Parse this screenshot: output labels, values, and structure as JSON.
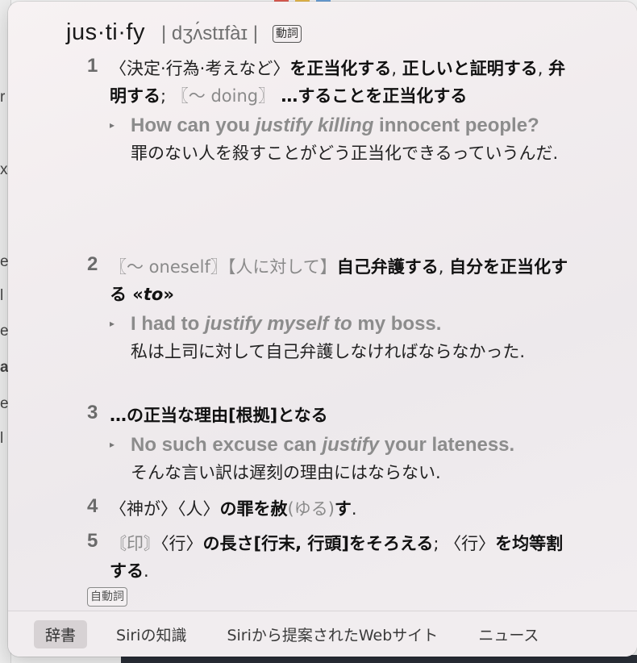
{
  "entry": {
    "headword": "jus·ti·fy",
    "pronunciation": "| dʒʌ́stɪfàɪ |",
    "pos_badge": "動詞",
    "intrans_badge": "自動詞"
  },
  "senses": [
    {
      "num": "1",
      "def_parts": [
        {
          "t": "〈決定·行為·考えなど〉",
          "s": "norm"
        },
        {
          "t": "を正当化する",
          "s": "bold"
        },
        {
          "t": ", ",
          "s": "norm"
        },
        {
          "t": "正しいと証明する",
          "s": "bold"
        },
        {
          "t": ", ",
          "s": "norm"
        },
        {
          "t": "弁明する",
          "s": "bold"
        },
        {
          "t": "; ",
          "s": "norm"
        },
        {
          "t": "〖～ doing〗",
          "s": "light"
        },
        {
          "t": " …することを正当化する",
          "s": "bold"
        }
      ],
      "example_en_parts": [
        {
          "t": "How can you ",
          "s": "norm"
        },
        {
          "t": "justify killing",
          "s": "it"
        },
        {
          "t": " innocent people?",
          "s": "norm"
        }
      ],
      "example_ja": "罪のない人を殺すことがどう正当化できるっていうんだ."
    },
    {
      "num": "2",
      "def_parts": [
        {
          "t": "〖～ oneself〗",
          "s": "light"
        },
        {
          "t": "【人に対して】",
          "s": "light"
        },
        {
          "t": "自己弁護する",
          "s": "bold"
        },
        {
          "t": ", ",
          "s": "norm"
        },
        {
          "t": "自分を正当化する",
          "s": "bold"
        },
        {
          "t": " «",
          "s": "bold"
        },
        {
          "t": "to",
          "s": "it"
        },
        {
          "t": "»",
          "s": "bold"
        }
      ],
      "example_en_parts": [
        {
          "t": "I had to ",
          "s": "norm"
        },
        {
          "t": "justify myself to",
          "s": "it"
        },
        {
          "t": " my boss.",
          "s": "norm"
        }
      ],
      "example_ja": "私は上司に対して自己弁護しなければならなかった."
    },
    {
      "num": "3",
      "def_parts": [
        {
          "t": "…の正当な理由[根拠]となる",
          "s": "bold"
        }
      ],
      "example_en_parts": [
        {
          "t": "No such excuse can ",
          "s": "norm"
        },
        {
          "t": "justify",
          "s": "it"
        },
        {
          "t": " your lateness.",
          "s": "norm"
        }
      ],
      "example_ja": "そんな言い訳は遅刻の理由にはならない."
    },
    {
      "num": "4",
      "def_parts": [
        {
          "t": "〈神が〉〈人〉",
          "s": "norm"
        },
        {
          "t": "の罪を赦",
          "s": "bold"
        },
        {
          "t": "(ゆる)",
          "s": "light"
        },
        {
          "t": "す",
          "s": "bold"
        },
        {
          "t": ".",
          "s": "norm"
        }
      ]
    },
    {
      "num": "5",
      "def_parts": [
        {
          "t": "〘印〙",
          "s": "light"
        },
        {
          "t": "〈行〉",
          "s": "norm"
        },
        {
          "t": "の長さ[行末, 行頭]をそろえる",
          "s": "bold"
        },
        {
          "t": "; ",
          "s": "norm"
        },
        {
          "t": "〈行〉",
          "s": "norm"
        },
        {
          "t": "を均等割する",
          "s": "bold"
        },
        {
          "t": ".",
          "s": "norm"
        }
      ]
    }
  ],
  "tabs": [
    {
      "label": "辞書",
      "active": true
    },
    {
      "label": "Siriの知識",
      "active": false
    },
    {
      "label": "Siriから提案されたWebサイト",
      "active": false
    },
    {
      "label": "ニュース",
      "active": false
    }
  ],
  "background": {
    "left_letters": [
      "r",
      "x",
      "e",
      "l",
      "e",
      "a",
      "e",
      "l"
    ]
  },
  "colors": {
    "popover_bg": "#f1ecee",
    "active_tab": "#d7d2d4"
  }
}
